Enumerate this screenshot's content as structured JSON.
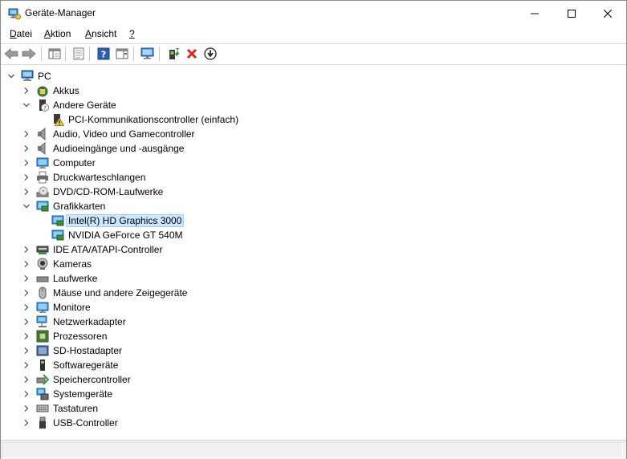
{
  "window": {
    "title": "Geräte-Manager",
    "controls": [
      "minimize",
      "maximize",
      "close"
    ]
  },
  "menu": [
    {
      "mnemonic": "D",
      "rest": "atei"
    },
    {
      "mnemonic": "A",
      "rest": "ktion"
    },
    {
      "mnemonic": "A",
      "rest": "nsicht"
    },
    {
      "mnemonic": "?",
      "rest": ""
    }
  ],
  "toolbar": {
    "icons": [
      "back-icon",
      "forward-icon",
      "show-hide-console-tree-icon",
      "properties-icon",
      "help-icon",
      "show-action-pane-icon",
      "scan-hardware-icon",
      "update-driver-icon",
      "uninstall-icon",
      "disable-device-icon"
    ]
  },
  "tree": {
    "root": "PC",
    "items": [
      {
        "label": "Akkus",
        "expanded": false,
        "icon": "battery-icon"
      },
      {
        "label": "Andere Geräte",
        "expanded": true,
        "icon": "unknown-device-icon",
        "children": [
          {
            "label": "PCI-Kommunikationscontroller (einfach)",
            "icon": "warning-device-icon"
          }
        ]
      },
      {
        "label": "Audio, Video und Gamecontroller",
        "expanded": false,
        "icon": "speaker-icon"
      },
      {
        "label": "Audioeingänge und -ausgänge",
        "expanded": false,
        "icon": "speaker-icon"
      },
      {
        "label": "Computer",
        "expanded": false,
        "icon": "monitor-icon"
      },
      {
        "label": "Druckwarteschlangen",
        "expanded": false,
        "icon": "printer-icon"
      },
      {
        "label": "DVD/CD-ROM-Laufwerke",
        "expanded": false,
        "icon": "optical-drive-icon"
      },
      {
        "label": "Grafikkarten",
        "expanded": true,
        "icon": "display-adapter-icon",
        "children": [
          {
            "label": "Intel(R) HD Graphics 3000",
            "icon": "display-adapter-icon",
            "selected": true
          },
          {
            "label": "NVIDIA GeForce GT 540M",
            "icon": "display-adapter-icon"
          }
        ]
      },
      {
        "label": "IDE ATA/ATAPI-Controller",
        "expanded": false,
        "icon": "ide-controller-icon"
      },
      {
        "label": "Kameras",
        "expanded": false,
        "icon": "camera-icon"
      },
      {
        "label": "Laufwerke",
        "expanded": false,
        "icon": "disk-drive-icon"
      },
      {
        "label": "Mäuse und andere Zeigegeräte",
        "expanded": false,
        "icon": "mouse-icon"
      },
      {
        "label": "Monitore",
        "expanded": false,
        "icon": "monitor-icon"
      },
      {
        "label": "Netzwerkadapter",
        "expanded": false,
        "icon": "network-adapter-icon"
      },
      {
        "label": "Prozessoren",
        "expanded": false,
        "icon": "processor-icon"
      },
      {
        "label": "SD-Hostadapter",
        "expanded": false,
        "icon": "sd-host-icon"
      },
      {
        "label": "Softwaregeräte",
        "expanded": false,
        "icon": "software-device-icon"
      },
      {
        "label": "Speichercontroller",
        "expanded": false,
        "icon": "storage-controller-icon"
      },
      {
        "label": "Systemgeräte",
        "expanded": false,
        "icon": "system-device-icon"
      },
      {
        "label": "Tastaturen",
        "expanded": false,
        "icon": "keyboard-icon"
      },
      {
        "label": "USB-Controller",
        "expanded": false,
        "icon": "usb-icon"
      }
    ]
  },
  "colors": {
    "selection_bg": "#cce8ff",
    "selection_border": "#99d1ff",
    "uninstall_red": "#e0201c",
    "help_blue": "#2d5fb4"
  }
}
